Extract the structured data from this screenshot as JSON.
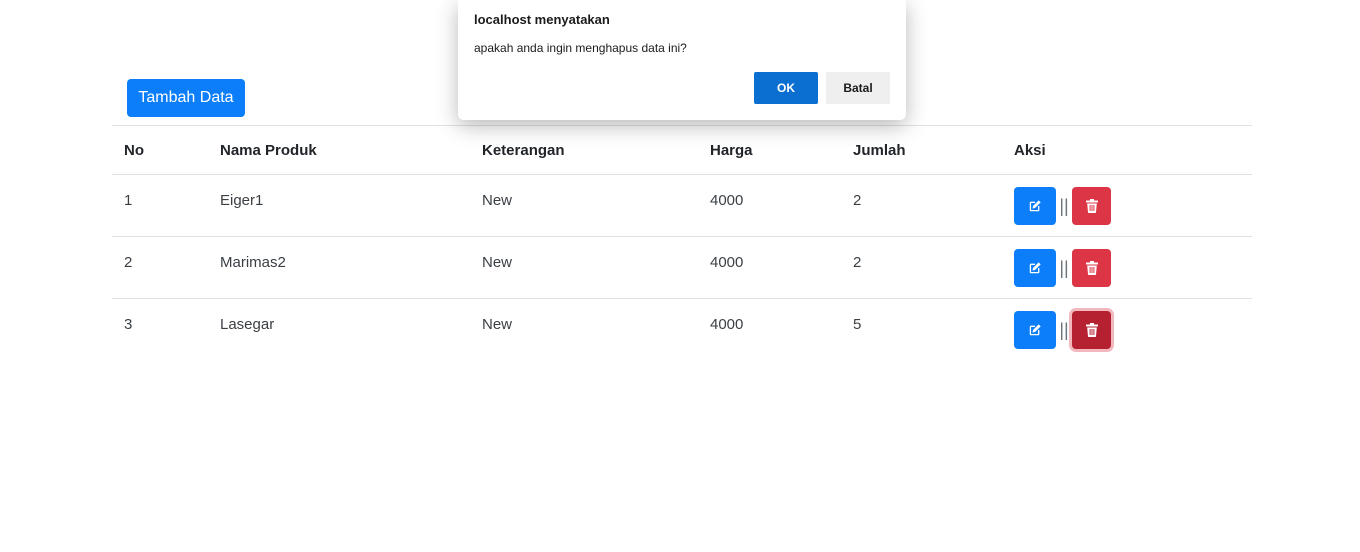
{
  "toolbar": {
    "add_label": "Tambah Data"
  },
  "table": {
    "headers": [
      "No",
      "Nama Produk",
      "Keterangan",
      "Harga",
      "Jumlah",
      "Aksi"
    ],
    "rows": [
      {
        "no": "1",
        "name": "Eiger1",
        "desc": "New",
        "price": "4000",
        "qty": "2",
        "separator": "||"
      },
      {
        "no": "2",
        "name": "Marimas2",
        "desc": "New",
        "price": "4000",
        "qty": "2",
        "separator": "||"
      },
      {
        "no": "3",
        "name": "Lasegar",
        "desc": "New",
        "price": "4000",
        "qty": "5",
        "separator": "||"
      }
    ],
    "edit_icon": "edit-icon",
    "delete_icon": "trash-icon"
  },
  "dialog": {
    "title": "localhost menyatakan",
    "message": "apakah anda ingin menghapus data ini?",
    "ok_label": "OK",
    "cancel_label": "Batal"
  },
  "colors": {
    "primary": "#0d7ef9",
    "danger": "#dc3545",
    "danger_active": "#b62131",
    "dialog_ok": "#0b6fd1"
  }
}
